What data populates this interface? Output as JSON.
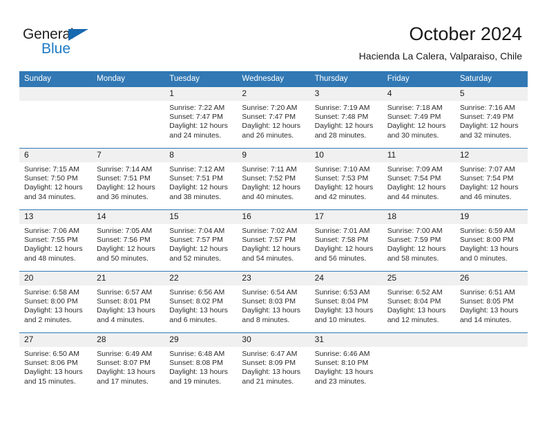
{
  "brand": {
    "line1": "General",
    "line2": "Blue",
    "triangle_color": "#1769b0",
    "blue_text_color": "#1e7ac4"
  },
  "header": {
    "title": "October 2024",
    "subtitle": "Hacienda La Calera, Valparaiso, Chile"
  },
  "theme": {
    "header_blue": "#3178b4",
    "daynum_bg": "#f0f0f0",
    "grid_line": "#3178b4"
  },
  "calendar": {
    "weekday_headers": [
      "Sunday",
      "Monday",
      "Tuesday",
      "Wednesday",
      "Thursday",
      "Friday",
      "Saturday"
    ],
    "weeks": [
      [
        {
          "day": "",
          "sunrise": "",
          "sunset": "",
          "daylight": ""
        },
        {
          "day": "",
          "sunrise": "",
          "sunset": "",
          "daylight": ""
        },
        {
          "day": "1",
          "sunrise": "Sunrise: 7:22 AM",
          "sunset": "Sunset: 7:47 PM",
          "daylight": "Daylight: 12 hours and 24 minutes."
        },
        {
          "day": "2",
          "sunrise": "Sunrise: 7:20 AM",
          "sunset": "Sunset: 7:47 PM",
          "daylight": "Daylight: 12 hours and 26 minutes."
        },
        {
          "day": "3",
          "sunrise": "Sunrise: 7:19 AM",
          "sunset": "Sunset: 7:48 PM",
          "daylight": "Daylight: 12 hours and 28 minutes."
        },
        {
          "day": "4",
          "sunrise": "Sunrise: 7:18 AM",
          "sunset": "Sunset: 7:49 PM",
          "daylight": "Daylight: 12 hours and 30 minutes."
        },
        {
          "day": "5",
          "sunrise": "Sunrise: 7:16 AM",
          "sunset": "Sunset: 7:49 PM",
          "daylight": "Daylight: 12 hours and 32 minutes."
        }
      ],
      [
        {
          "day": "6",
          "sunrise": "Sunrise: 7:15 AM",
          "sunset": "Sunset: 7:50 PM",
          "daylight": "Daylight: 12 hours and 34 minutes."
        },
        {
          "day": "7",
          "sunrise": "Sunrise: 7:14 AM",
          "sunset": "Sunset: 7:51 PM",
          "daylight": "Daylight: 12 hours and 36 minutes."
        },
        {
          "day": "8",
          "sunrise": "Sunrise: 7:12 AM",
          "sunset": "Sunset: 7:51 PM",
          "daylight": "Daylight: 12 hours and 38 minutes."
        },
        {
          "day": "9",
          "sunrise": "Sunrise: 7:11 AM",
          "sunset": "Sunset: 7:52 PM",
          "daylight": "Daylight: 12 hours and 40 minutes."
        },
        {
          "day": "10",
          "sunrise": "Sunrise: 7:10 AM",
          "sunset": "Sunset: 7:53 PM",
          "daylight": "Daylight: 12 hours and 42 minutes."
        },
        {
          "day": "11",
          "sunrise": "Sunrise: 7:09 AM",
          "sunset": "Sunset: 7:54 PM",
          "daylight": "Daylight: 12 hours and 44 minutes."
        },
        {
          "day": "12",
          "sunrise": "Sunrise: 7:07 AM",
          "sunset": "Sunset: 7:54 PM",
          "daylight": "Daylight: 12 hours and 46 minutes."
        }
      ],
      [
        {
          "day": "13",
          "sunrise": "Sunrise: 7:06 AM",
          "sunset": "Sunset: 7:55 PM",
          "daylight": "Daylight: 12 hours and 48 minutes."
        },
        {
          "day": "14",
          "sunrise": "Sunrise: 7:05 AM",
          "sunset": "Sunset: 7:56 PM",
          "daylight": "Daylight: 12 hours and 50 minutes."
        },
        {
          "day": "15",
          "sunrise": "Sunrise: 7:04 AM",
          "sunset": "Sunset: 7:57 PM",
          "daylight": "Daylight: 12 hours and 52 minutes."
        },
        {
          "day": "16",
          "sunrise": "Sunrise: 7:02 AM",
          "sunset": "Sunset: 7:57 PM",
          "daylight": "Daylight: 12 hours and 54 minutes."
        },
        {
          "day": "17",
          "sunrise": "Sunrise: 7:01 AM",
          "sunset": "Sunset: 7:58 PM",
          "daylight": "Daylight: 12 hours and 56 minutes."
        },
        {
          "day": "18",
          "sunrise": "Sunrise: 7:00 AM",
          "sunset": "Sunset: 7:59 PM",
          "daylight": "Daylight: 12 hours and 58 minutes."
        },
        {
          "day": "19",
          "sunrise": "Sunrise: 6:59 AM",
          "sunset": "Sunset: 8:00 PM",
          "daylight": "Daylight: 13 hours and 0 minutes."
        }
      ],
      [
        {
          "day": "20",
          "sunrise": "Sunrise: 6:58 AM",
          "sunset": "Sunset: 8:00 PM",
          "daylight": "Daylight: 13 hours and 2 minutes."
        },
        {
          "day": "21",
          "sunrise": "Sunrise: 6:57 AM",
          "sunset": "Sunset: 8:01 PM",
          "daylight": "Daylight: 13 hours and 4 minutes."
        },
        {
          "day": "22",
          "sunrise": "Sunrise: 6:56 AM",
          "sunset": "Sunset: 8:02 PM",
          "daylight": "Daylight: 13 hours and 6 minutes."
        },
        {
          "day": "23",
          "sunrise": "Sunrise: 6:54 AM",
          "sunset": "Sunset: 8:03 PM",
          "daylight": "Daylight: 13 hours and 8 minutes."
        },
        {
          "day": "24",
          "sunrise": "Sunrise: 6:53 AM",
          "sunset": "Sunset: 8:04 PM",
          "daylight": "Daylight: 13 hours and 10 minutes."
        },
        {
          "day": "25",
          "sunrise": "Sunrise: 6:52 AM",
          "sunset": "Sunset: 8:04 PM",
          "daylight": "Daylight: 13 hours and 12 minutes."
        },
        {
          "day": "26",
          "sunrise": "Sunrise: 6:51 AM",
          "sunset": "Sunset: 8:05 PM",
          "daylight": "Daylight: 13 hours and 14 minutes."
        }
      ],
      [
        {
          "day": "27",
          "sunrise": "Sunrise: 6:50 AM",
          "sunset": "Sunset: 8:06 PM",
          "daylight": "Daylight: 13 hours and 15 minutes."
        },
        {
          "day": "28",
          "sunrise": "Sunrise: 6:49 AM",
          "sunset": "Sunset: 8:07 PM",
          "daylight": "Daylight: 13 hours and 17 minutes."
        },
        {
          "day": "29",
          "sunrise": "Sunrise: 6:48 AM",
          "sunset": "Sunset: 8:08 PM",
          "daylight": "Daylight: 13 hours and 19 minutes."
        },
        {
          "day": "30",
          "sunrise": "Sunrise: 6:47 AM",
          "sunset": "Sunset: 8:09 PM",
          "daylight": "Daylight: 13 hours and 21 minutes."
        },
        {
          "day": "31",
          "sunrise": "Sunrise: 6:46 AM",
          "sunset": "Sunset: 8:10 PM",
          "daylight": "Daylight: 13 hours and 23 minutes."
        },
        {
          "day": "",
          "sunrise": "",
          "sunset": "",
          "daylight": ""
        },
        {
          "day": "",
          "sunrise": "",
          "sunset": "",
          "daylight": ""
        }
      ]
    ]
  }
}
